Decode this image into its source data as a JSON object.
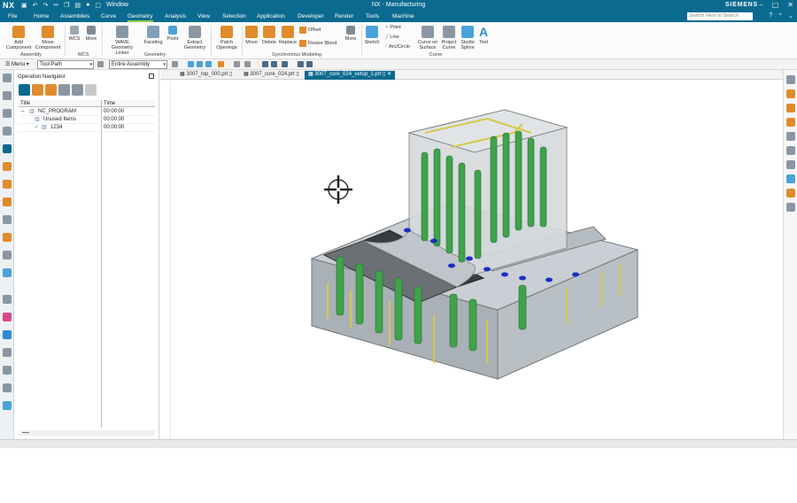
{
  "app": {
    "logo": "NX",
    "title": "NX - Manufacturing",
    "brand": "SIEMENS",
    "window_menu": "Window",
    "quick_access_icons": [
      "save-icon",
      "undo-icon",
      "redo-icon",
      "cut-icon",
      "copy-icon",
      "paste-icon",
      "mic-icon",
      "window-icon"
    ]
  },
  "menubar": {
    "tabs": [
      "File",
      "Home",
      "Assemblies",
      "Curve",
      "Geometry",
      "Analysis",
      "View",
      "Selection",
      "Application",
      "Developer",
      "Render",
      "Tools",
      "Machine"
    ],
    "active_tab": "Geometry",
    "search_placeholder": "Search Here to Search"
  },
  "ribbon": {
    "add_component": "Add Component",
    "move_component": "Move Component",
    "group_assembly": "Assembly",
    "wcs_btn1": "WCS",
    "more1": "More",
    "group_wcs": "WCS",
    "wave_linker": "WAVE Geometry Linker",
    "faceting": "Faceting",
    "point": "Point",
    "extract_geometry": "Extract Geometry",
    "group_geometry": "Geometry",
    "patch_openings": "Patch Openings",
    "move": "Move",
    "delete": "Delete",
    "replace": "Replace",
    "offset": "Offset",
    "resize_blend": "Resize Blend",
    "more2": "More",
    "group_sync": "Synchronous Modeling",
    "sketch": "Sketch",
    "pt": "Point",
    "line": "Line",
    "arc_circle": "Arc/Circle",
    "curve_on_surface": "Curve on Surface",
    "project_curve": "Project Curve",
    "studio_spline": "Studio Spline",
    "text": "Text",
    "group_curve": "Curve"
  },
  "toolbar": {
    "menu_label": "Menu",
    "filter1": "Tool Path",
    "filter2": "Entire Assembly"
  },
  "navigator": {
    "title": "Operation Navigator",
    "col_title": "Title",
    "col_time": "Time",
    "rows": [
      {
        "name": "NC_PROGRAM",
        "time": "00:00:00"
      },
      {
        "name": "Unused Items",
        "time": "00:00:00"
      },
      {
        "name": "1234",
        "time": "00:00:00"
      }
    ]
  },
  "file_tabs": [
    "3007_top_000.prt",
    "3007_core_024.prt",
    "3007_core_024_setup_1.prt"
  ],
  "active_file_tab": 2,
  "colors": {
    "accent": "#0b6a8f",
    "active_underline": "#8fd14f",
    "cooling_green": "#3fa34a",
    "pin_yellow": "#d6c84a",
    "hole_blue": "#1c2fbf"
  }
}
